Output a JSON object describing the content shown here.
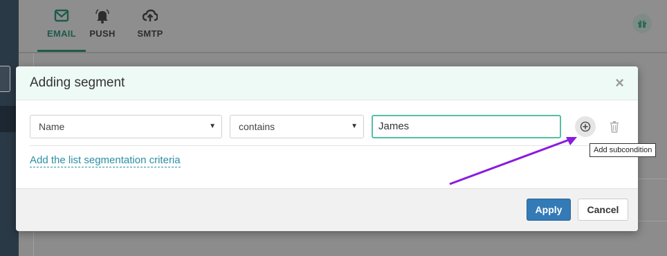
{
  "nav": {
    "tabs": [
      {
        "label": "EMAIL",
        "icon": "envelope-icon",
        "active": true
      },
      {
        "label": "PUSH",
        "icon": "bell-icon",
        "active": false
      },
      {
        "label": "SMTP",
        "icon": "cloud-upload-icon",
        "active": false
      }
    ],
    "gift_icon": "gift-icon"
  },
  "modal": {
    "title": "Adding segment",
    "close_icon": "close-icon",
    "condition": {
      "field_select": "Name",
      "operator_select": "contains",
      "value_input": "James"
    },
    "add_subcondition_icon": "plus-circle-icon",
    "delete_icon": "trash-icon",
    "add_criteria_link": "Add the list segmentation criteria",
    "apply_label": "Apply",
    "cancel_label": "Cancel"
  },
  "tooltip": {
    "text": "Add subcondition"
  },
  "colors": {
    "accent_green": "#1e5a4a",
    "input_focus": "#54c0a3",
    "link": "#2a8fa3",
    "primary_button": "#337ab7",
    "annotation_arrow": "#8a1be0"
  }
}
